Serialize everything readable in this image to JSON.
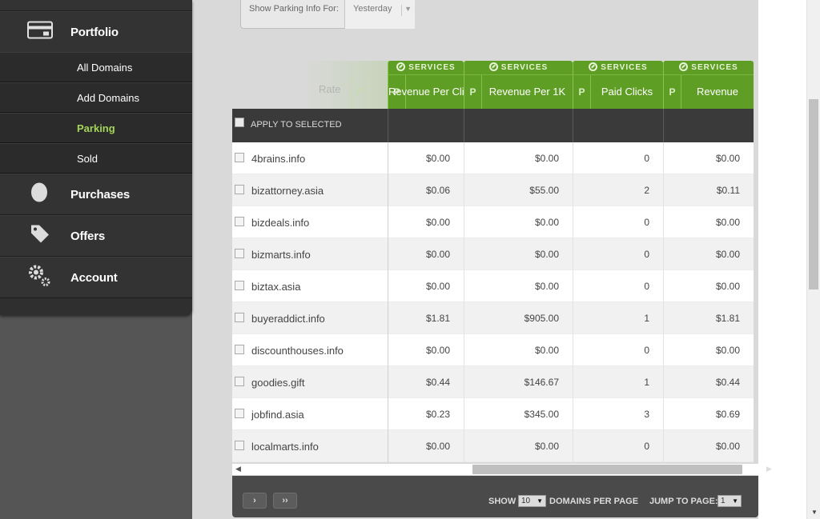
{
  "sidebar": {
    "main_items": [
      {
        "label": "Portfolio",
        "icon": "portfolio-card-icon"
      },
      {
        "label": "Purchases",
        "icon": "egg-icon"
      },
      {
        "label": "Offers",
        "icon": "tag-icon"
      },
      {
        "label": "Account",
        "icon": "gears-icon"
      }
    ],
    "sub_items": [
      {
        "label": "All Domains"
      },
      {
        "label": "Add Domains"
      },
      {
        "label": "Parking",
        "active": true
      },
      {
        "label": "Sold"
      }
    ]
  },
  "filter": {
    "label": "Show Parking Info For:",
    "value": "Yesterday"
  },
  "grid": {
    "ghost_header": "Rate",
    "ghost_p": "P",
    "columns": [
      {
        "service": "SERVICES",
        "p": "P",
        "title": "Revenue Per Click"
      },
      {
        "service": "SERVICES",
        "p": "P",
        "title": "Revenue Per 1K"
      },
      {
        "service": "SERVICES",
        "p": "P",
        "title": "Paid Clicks"
      },
      {
        "service": "SERVICES",
        "p": "P",
        "title": "Revenue"
      }
    ],
    "apply_label": "APPLY TO SELECTED",
    "rows": [
      {
        "domain": "4brains.info",
        "rpc": "$0.00",
        "rp1k": "$0.00",
        "clicks": "0",
        "revenue": "$0.00"
      },
      {
        "domain": "bizattorney.asia",
        "rpc": "$0.06",
        "rp1k": "$55.00",
        "clicks": "2",
        "revenue": "$0.11"
      },
      {
        "domain": "bizdeals.info",
        "rpc": "$0.00",
        "rp1k": "$0.00",
        "clicks": "0",
        "revenue": "$0.00"
      },
      {
        "domain": "bizmarts.info",
        "rpc": "$0.00",
        "rp1k": "$0.00",
        "clicks": "0",
        "revenue": "$0.00"
      },
      {
        "domain": "biztax.asia",
        "rpc": "$0.00",
        "rp1k": "$0.00",
        "clicks": "0",
        "revenue": "$0.00"
      },
      {
        "domain": "buyeraddict.info",
        "rpc": "$1.81",
        "rp1k": "$905.00",
        "clicks": "1",
        "revenue": "$1.81"
      },
      {
        "domain": "discounthouses.info",
        "rpc": "$0.00",
        "rp1k": "$0.00",
        "clicks": "0",
        "revenue": "$0.00"
      },
      {
        "domain": "goodies.gift",
        "rpc": "$0.44",
        "rp1k": "$146.67",
        "clicks": "1",
        "revenue": "$0.44"
      },
      {
        "domain": "jobfind.asia",
        "rpc": "$0.23",
        "rp1k": "$345.00",
        "clicks": "3",
        "revenue": "$0.69"
      },
      {
        "domain": "localmarts.info",
        "rpc": "$0.00",
        "rp1k": "$0.00",
        "clicks": "0",
        "revenue": "$0.00"
      }
    ]
  },
  "pager": {
    "next": "›",
    "last": "››",
    "show_label": "SHOW",
    "per_page_value": "10",
    "per_page_label": "DOMAINS PER PAGE",
    "jump_label": "JUMP TO PAGE:",
    "page_value": "1"
  },
  "colors": {
    "accent_green": "#5f9e25",
    "active_nav": "#a5d45a",
    "sidebar_dark": "#2f2f2f"
  }
}
